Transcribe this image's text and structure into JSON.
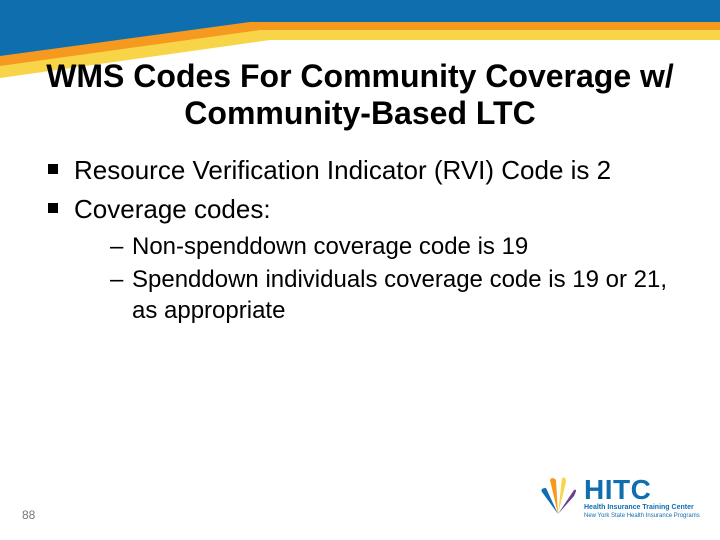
{
  "title": "WMS Codes For Community Coverage w/ Community-Based LTC",
  "bullets": {
    "item0": "Resource Verification Indicator (RVI) Code is 2",
    "item1": "Coverage codes:"
  },
  "sub_bullets": {
    "item0": "Non-spenddown coverage code is 19",
    "item1": "Spenddown individuals coverage code is 19 or 21, as appropriate"
  },
  "page_number": "88",
  "logo": {
    "acronym": "HITC",
    "line1": "Health Insurance Training Center",
    "line2": "New York State Health Insurance Programs"
  },
  "colors": {
    "blue": "#0f6fae",
    "orange": "#f59a1f",
    "yellow": "#f8d548"
  }
}
